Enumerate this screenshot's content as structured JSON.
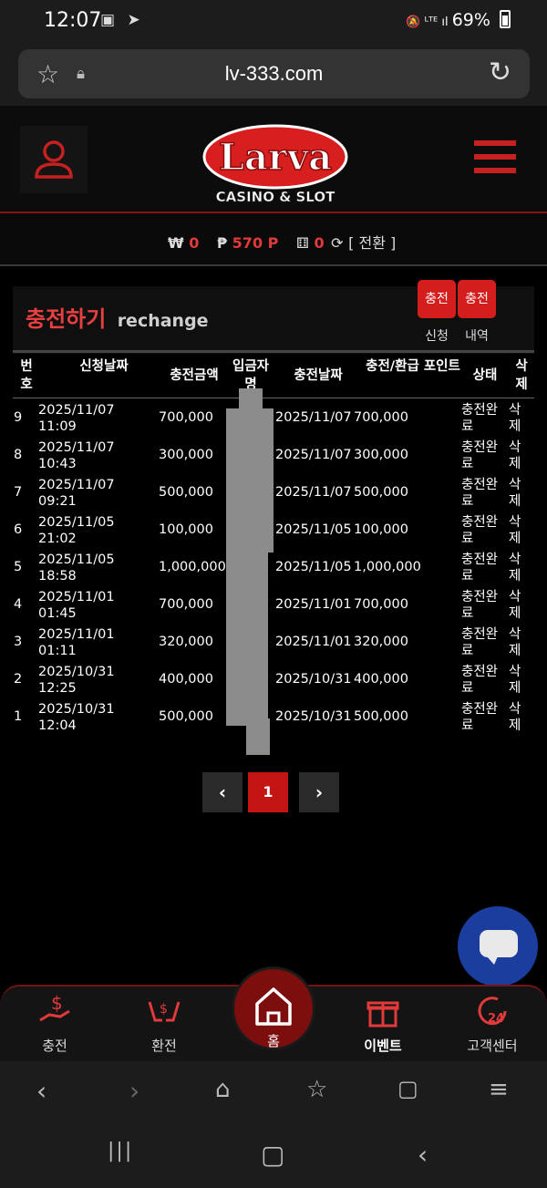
{
  "status": {
    "time": "12:07",
    "right_text": "69%",
    "signal": "LTE"
  },
  "browser": {
    "url": "lv-333.com"
  },
  "logo": {
    "name": "Larva",
    "sub": "CASINO & SLOT"
  },
  "balance": {
    "won_symbol": "₩",
    "won_value": "0",
    "point_symbol": "₱",
    "point_value": "570 P",
    "chip_value": "0",
    "switch_label": "[ 전환 ]"
  },
  "panel": {
    "title": "충전하기",
    "subtitle": "rechange",
    "btn_apply": "충전",
    "btn_apply_label": "신청",
    "btn_history": "충전",
    "btn_history_label": "내역"
  },
  "table": {
    "headers": [
      "번호",
      "신청날짜",
      "충전금액",
      "입금자명",
      "충전날짜",
      "충전/환급 포인트",
      "상태",
      "삭제"
    ],
    "rows": [
      {
        "no": "9",
        "date": "2025/11/07",
        "time": "11:09",
        "amount": "700,000",
        "charge_date": "2025/11/07",
        "points": "700,000",
        "status": "충전완료",
        "del": "삭제"
      },
      {
        "no": "8",
        "date": "2025/11/07",
        "time": "10:43",
        "amount": "300,000",
        "charge_date": "2025/11/07",
        "points": "300,000",
        "status": "충전완료",
        "del": "삭제"
      },
      {
        "no": "7",
        "date": "2025/11/07",
        "time": "09:21",
        "amount": "500,000",
        "charge_date": "2025/11/07",
        "points": "500,000",
        "status": "충전완료",
        "del": "삭제"
      },
      {
        "no": "6",
        "date": "2025/11/05",
        "time": "21:02",
        "amount": "100,000",
        "charge_date": "2025/11/05",
        "points": "100,000",
        "status": "충전완료",
        "del": "삭제"
      },
      {
        "no": "5",
        "date": "2025/11/05",
        "time": "18:58",
        "amount": "1,000,000",
        "charge_date": "2025/11/05",
        "points": "1,000,000",
        "status": "충전완료",
        "del": "삭제"
      },
      {
        "no": "4",
        "date": "2025/11/01",
        "time": "01:45",
        "amount": "700,000",
        "charge_date": "2025/11/01",
        "points": "700,000",
        "status": "충전완료",
        "del": "삭제"
      },
      {
        "no": "3",
        "date": "2025/11/01",
        "time": "01:11",
        "amount": "320,000",
        "charge_date": "2025/11/01",
        "points": "320,000",
        "status": "충전완료",
        "del": "삭제"
      },
      {
        "no": "2",
        "date": "2025/10/31",
        "time": "12:25",
        "amount": "400,000",
        "charge_date": "2025/10/31",
        "points": "400,000",
        "status": "충전완료",
        "del": "삭제"
      },
      {
        "no": "1",
        "date": "2025/10/31",
        "time": "12:04",
        "amount": "500,000",
        "charge_date": "2025/10/31",
        "points": "500,000",
        "status": "충전완료",
        "del": "삭제"
      }
    ]
  },
  "pager": {
    "prev": "‹",
    "current": "1",
    "next": "›"
  },
  "bottom_nav": {
    "charge": "충전",
    "exchange": "환전",
    "home": "홈",
    "event": "이벤트",
    "support": "고객센터"
  },
  "colors": {
    "accent": "#d41d1d",
    "bg": "#000000",
    "chat": "#1a3d9e"
  }
}
